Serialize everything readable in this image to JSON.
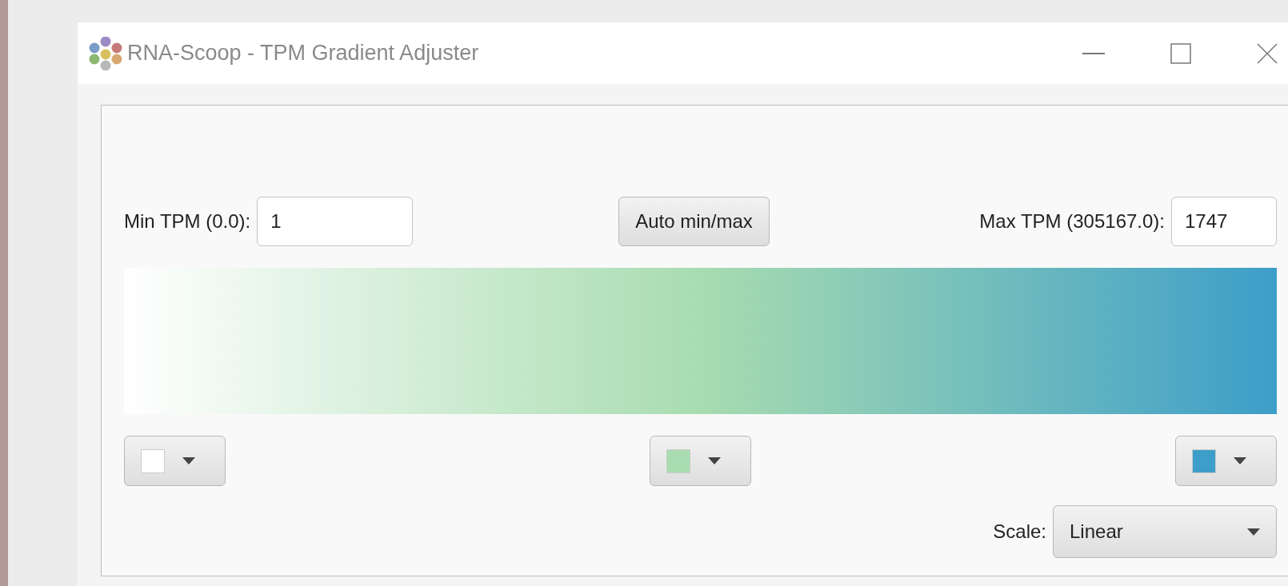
{
  "window": {
    "title": "RNA-Scoop - TPM Gradient Adjuster"
  },
  "min_tpm": {
    "label": "Min TPM (0.0):",
    "value": "1"
  },
  "auto_button": {
    "label": "Auto min/max"
  },
  "max_tpm": {
    "label": "Max TPM (305167.0):",
    "value": "1747"
  },
  "color_pickers": [
    {
      "color": "#ffffff"
    },
    {
      "color": "#a8dcb0"
    },
    {
      "color": "#3d9ec9"
    }
  ],
  "scale": {
    "label": "Scale:",
    "value": "Linear"
  }
}
